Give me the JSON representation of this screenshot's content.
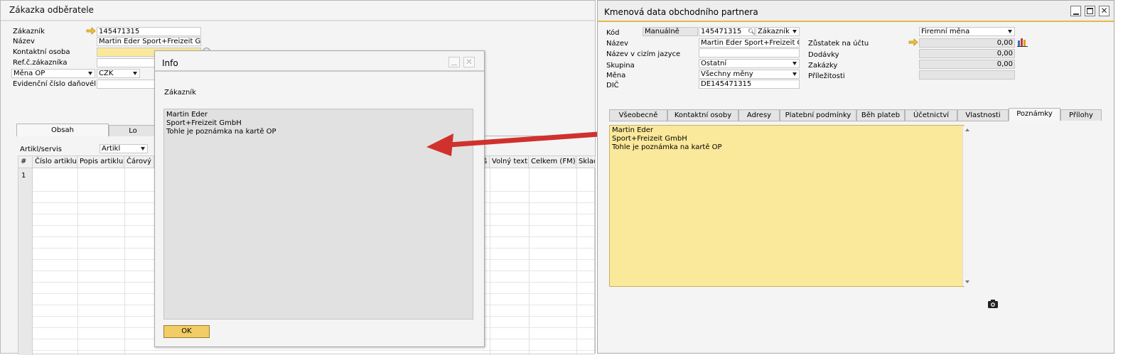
{
  "sales_order": {
    "title": "Zákazka odběratele",
    "fields": {
      "customer_label": "Zákazník",
      "customer_value": "145471315",
      "name_label": "Název",
      "name_value": "Martin Eder Sport+Freizeit Gmbl",
      "contact_label": "Kontaktní osoba",
      "ref_label": "Ref.č.zákazníka",
      "currency_select": "Měna OP",
      "currency_value": "CZK",
      "tax_label": "Evidenční číslo daňovél"
    },
    "tabs": [
      "Obsah",
      "Lo"
    ],
    "item_type_label": "Artikl/servis",
    "item_type_value": "Artikl",
    "grid_headers_left": [
      "#",
      "Číslo artiklu",
      "Popis artiklu",
      "Čárový"
    ],
    "grid_headers_right": [
      "š",
      "Volný text",
      "Celkem (FM)",
      "Sklad"
    ],
    "first_row": "1"
  },
  "info_dialog": {
    "title": "Info",
    "heading": "Zákazník",
    "lines": [
      "Martin Eder",
      "Sport+Freizeit GmbH",
      "Tohle je poznámka na kartě OP"
    ],
    "ok_label": "OK"
  },
  "bp_master": {
    "title": "Kmenová data obchodního partnera",
    "code_label": "Kód",
    "series_value": "Manuálně",
    "code_value": "145471315",
    "type_value": "Zákazník",
    "name_label": "Název",
    "name_value": "Martin Eder Sport+Freizeit Gmbl",
    "foreign_name_label": "Název v cizím jazyce",
    "group_label": "Skupina",
    "group_value": "Ostatní",
    "currency_label": "Měna",
    "currency_value": "Všechny měny",
    "vat_label": "DIČ",
    "vat_value": "DE145471315",
    "company_currency": "Firemní měna",
    "balances": [
      {
        "label": "Zůstatek na účtu",
        "value": "0,00"
      },
      {
        "label": "Dodávky",
        "value": "0,00"
      },
      {
        "label": "Zakázky",
        "value": "0,00"
      },
      {
        "label": "Příležitosti",
        "value": ""
      }
    ],
    "tabs": [
      "Všeobecně",
      "Kontaktní osoby",
      "Adresy",
      "Platební podmínky",
      "Běh plateb",
      "Účetnictví",
      "Vlastnosti",
      "Poznámky",
      "Přílohy"
    ],
    "notes_lines": [
      "Martin Eder",
      "Sport+Freizeit GmbH",
      "Tohle je poznámka na kartě OP"
    ]
  },
  "colors": {
    "accent_line": "#e8b84a",
    "note_yellow": "#fbe99b",
    "arrow_red": "#e23a3a"
  },
  "icons": [
    "link-arrow-icon",
    "search-icon",
    "bar-chart-icon",
    "camera-icon",
    "minimize-icon",
    "maximize-icon",
    "close-icon",
    "dropdown-arrow-icon"
  ]
}
